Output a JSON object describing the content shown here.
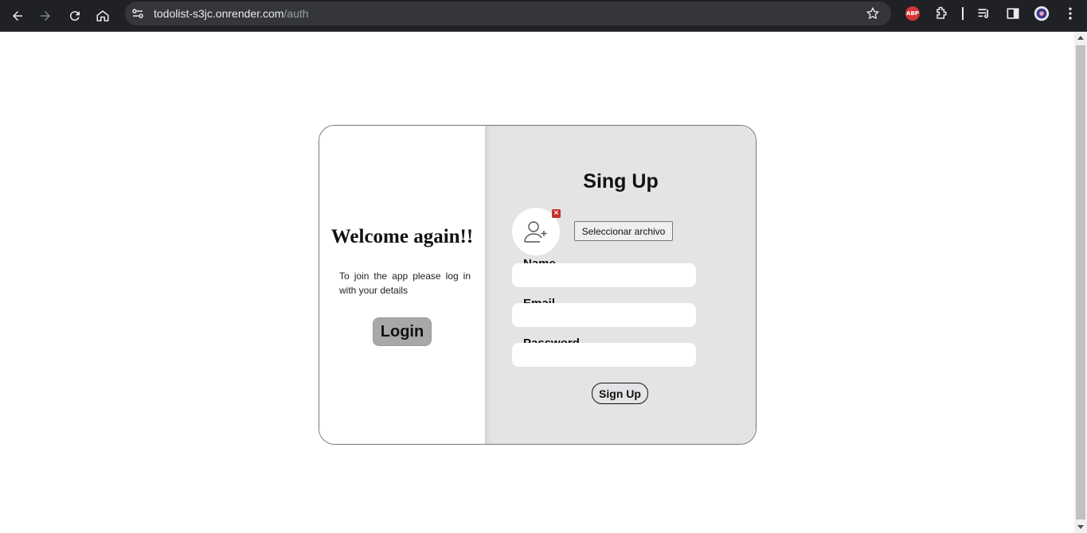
{
  "browser": {
    "url_host": "todolist-s3jc.onrender.com",
    "url_path": "/auth",
    "icons": [
      "back-icon",
      "forward-icon",
      "reload-icon",
      "home-icon",
      "site-settings-icon",
      "bookmark-star-icon",
      "adblock-icon",
      "extensions-icon",
      "media-icon",
      "side-panel-icon",
      "profile-icon",
      "menu-icon"
    ],
    "adblock_label": "ABP"
  },
  "login_panel": {
    "title": "Welcome again!!",
    "subtitle": "To join the app please log in with your details",
    "login_label": "Login"
  },
  "signup_panel": {
    "title": "Sing Up",
    "file_button_label": "Seleccionar archivo",
    "remove_label": "×",
    "fields": [
      {
        "label": "Name",
        "value": ""
      },
      {
        "label": "Email",
        "value": ""
      },
      {
        "label": "Password",
        "value": ""
      }
    ],
    "submit_label": "Sign Up"
  },
  "colors": {
    "right_panel_bg": "#e4e4e7",
    "login_button_bg": "#a8a8a8",
    "remove_badge": "#c9302c"
  }
}
